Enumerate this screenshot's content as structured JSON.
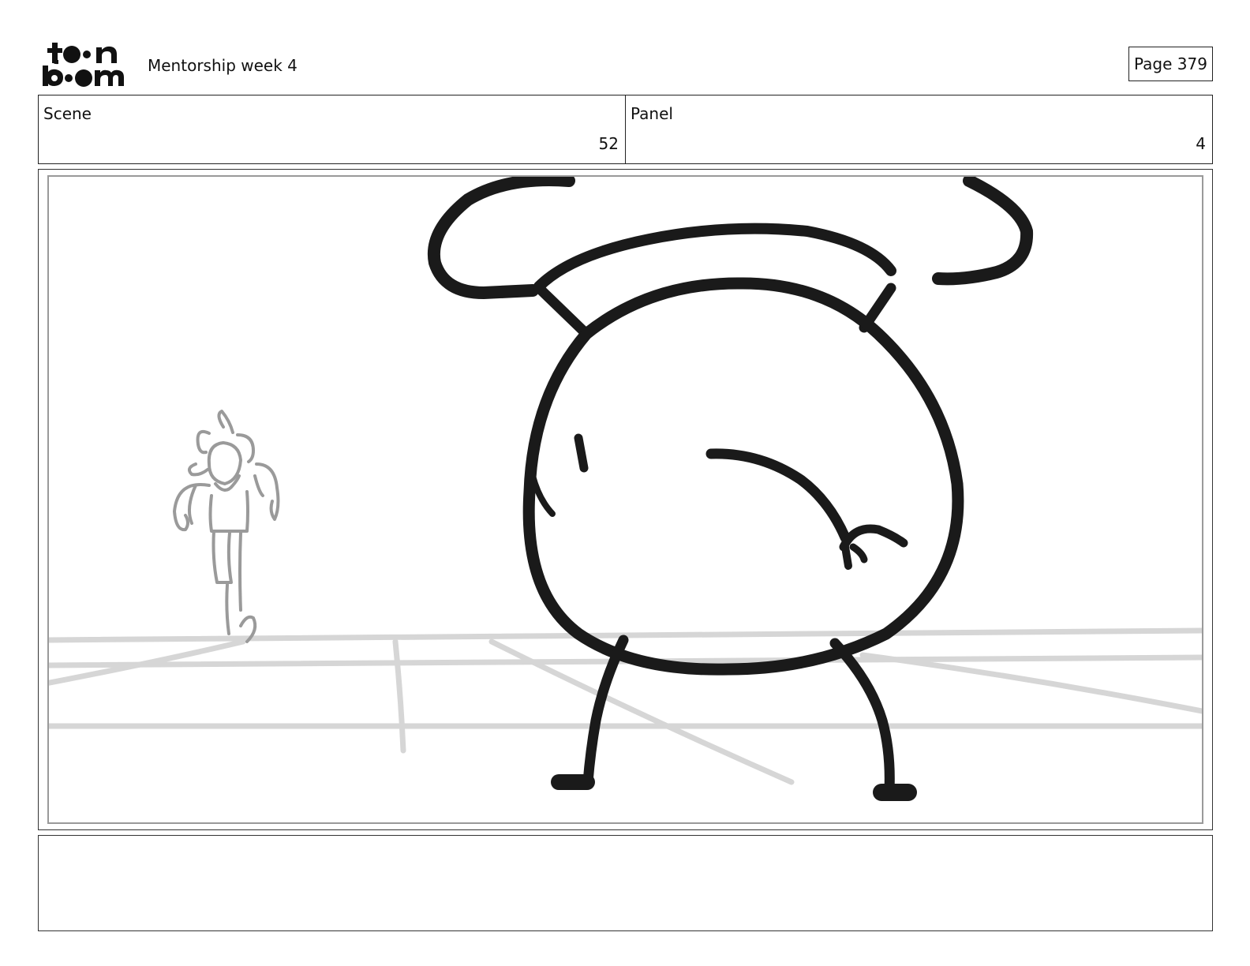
{
  "header": {
    "logo_text": "toon boom",
    "document_title": "Mentorship week 4",
    "page_label": "Page 379"
  },
  "info": {
    "scene_label": "Scene",
    "scene_value": "52",
    "panel_label": "Panel",
    "panel_value": "4"
  },
  "panel_drawing": {
    "description_icon": "storyboard-sketch",
    "foreground_line_color": "#1a1a1a",
    "background_line_color": "#9a9a9a",
    "floor_line_color": "#d6d6d6"
  },
  "notes": {
    "text": ""
  }
}
